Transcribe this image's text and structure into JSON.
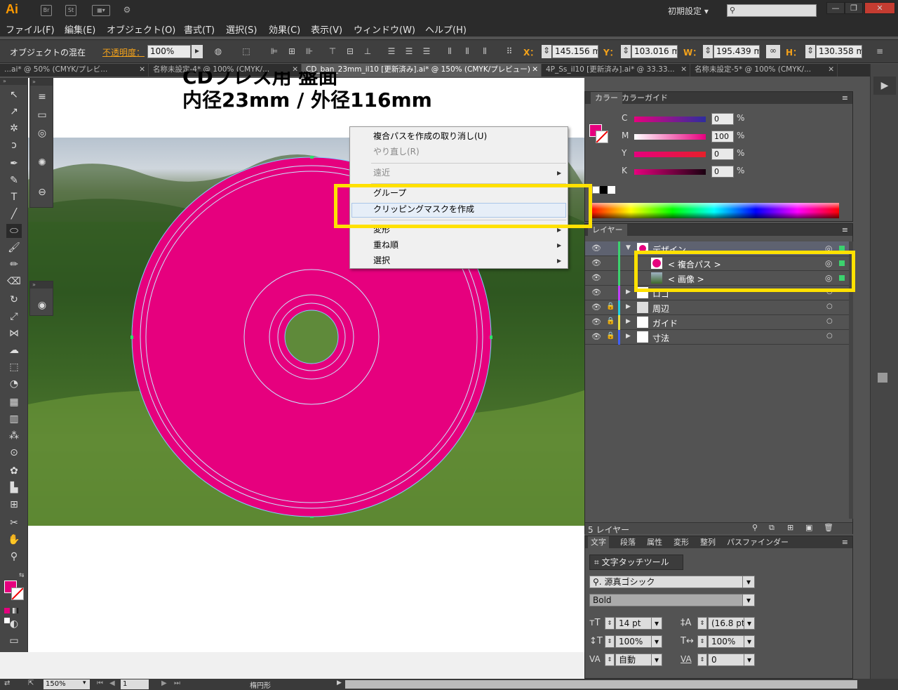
{
  "app": {
    "logo": "Ai",
    "title_buttons": [
      "Br",
      "St"
    ],
    "preset": "初期設定",
    "search_placeholder": "",
    "window_buttons": [
      "—",
      "❐",
      "✕"
    ]
  },
  "menu": [
    "ファイル(F)",
    "編集(E)",
    "オブジェクト(O)",
    "書式(T)",
    "選択(S)",
    "効果(C)",
    "表示(V)",
    "ウィンドウ(W)",
    "ヘルプ(H)"
  ],
  "control": {
    "mode_label": "オブジェクトの混在",
    "opacity_label": "不透明度：",
    "opacity": "100%",
    "x_label": "X：",
    "x": "145.156 m",
    "y_label": "Y：",
    "y": "103.016 m",
    "w_label": "W：",
    "w": "195.439 m",
    "h_label": "H：",
    "h": "130.358 m"
  },
  "tabs": [
    {
      "label": "...ai* @ 50% (CMYK/プレビ..."
    },
    {
      "label": "名称未設定-4* @ 100% (CMYK/..."
    },
    {
      "label": "CD_ban_23mm_il10 [更新済み].ai* @ 150% (CMYK/プレビュー)"
    },
    {
      "label": "4P_Ss_il10 [更新済み].ai* @ 33.33..."
    },
    {
      "label": "名称未設定-5* @ 100% (CMYK/..."
    }
  ],
  "canvas": {
    "heading_top": "CDプレス用 盤面",
    "heading": "内径23mm / 外径116mm"
  },
  "context_menu": {
    "items": [
      {
        "label": "複合パスを作成の取り消し(U)",
        "disabled": false,
        "submenu": false
      },
      {
        "label": "やり直し(R)",
        "disabled": true,
        "submenu": false
      },
      {
        "label": "遠近",
        "disabled": true,
        "submenu": true
      },
      {
        "label": "グループ",
        "disabled": false,
        "submenu": false
      },
      {
        "label": "クリッピングマスクを作成",
        "disabled": false,
        "submenu": false,
        "highlighted": true
      },
      {
        "label": "変形",
        "disabled": false,
        "submenu": true
      },
      {
        "label": "重ね順",
        "disabled": false,
        "submenu": true
      },
      {
        "label": "選択",
        "disabled": false,
        "submenu": true
      }
    ]
  },
  "color_panel": {
    "tabs": [
      "カラー",
      "カラーガイド"
    ],
    "channels": [
      {
        "label": "C",
        "value": "0",
        "color": "#ec008c"
      },
      {
        "label": "M",
        "value": "100",
        "color": "#ec008c"
      },
      {
        "label": "Y",
        "value": "0",
        "color": "#ec008c"
      },
      {
        "label": "K",
        "value": "0",
        "color": "#ec008c"
      }
    ],
    "unit": "%",
    "fill_color": "#e6007e"
  },
  "layers_panel": {
    "title": "レイヤー",
    "rows": [
      {
        "name": "デザイン",
        "color": "#3cd26e",
        "indent": 0,
        "expanded": true
      },
      {
        "name": "< 複合パス >",
        "color": "#3cd26e",
        "indent": 1
      },
      {
        "name": "< 画像 >",
        "color": "#3cd26e",
        "indent": 1
      },
      {
        "name": "ロゴ",
        "color": "#c040ff",
        "indent": 0
      },
      {
        "name": "周辺",
        "color": "#22d0e0",
        "indent": 0
      },
      {
        "name": "ガイド",
        "color": "#e8e040",
        "indent": 0
      },
      {
        "name": "寸法",
        "color": "#4060ff",
        "indent": 0
      }
    ],
    "footer": "5 レイヤー"
  },
  "char_panel": {
    "tabs": [
      "文字",
      "段落",
      "属性",
      "変形",
      "整列",
      "パスファインダー"
    ],
    "touch_tool": "文字タッチツール",
    "font": "源真ゴシック",
    "style": "Bold",
    "size": "14 pt",
    "leading": "(16.8 pt",
    "hscale": "100%",
    "vscale": "100%",
    "kerning": "自動",
    "tracking": "0"
  },
  "status": {
    "zoom": "150%",
    "page": "1",
    "selection": "楕円形"
  },
  "colors": {
    "magenta": "#e6007e",
    "highlight_yellow": "#ffe100"
  }
}
